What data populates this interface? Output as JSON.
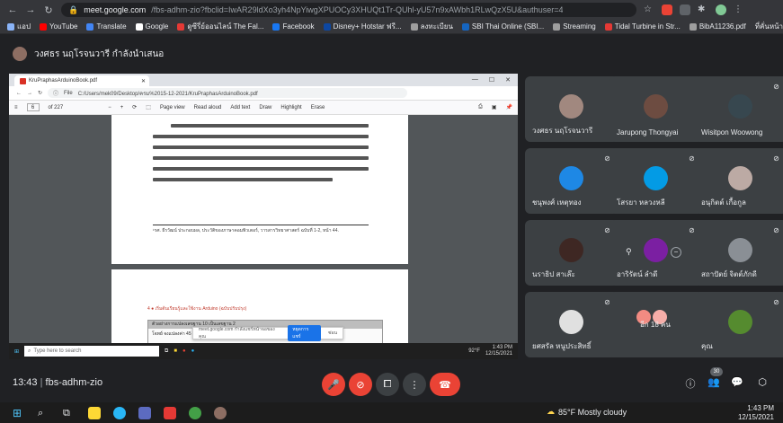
{
  "browser": {
    "url_host": "meet.google.com",
    "url_rest": "/fbs-adhm-zio?fbclid=IwAR29ldXo3yh4NpYiwgXPUOCy3XHUQt1Tr-QUhl-yU57n9xAWbh1RLwQzX5U&authuser=4",
    "bookmarks": [
      {
        "label": "แอป",
        "color": "#8ab4f8"
      },
      {
        "label": "YouTube",
        "color": "#ff0000"
      },
      {
        "label": "Translate",
        "color": "#4285f4"
      },
      {
        "label": "Google",
        "color": "#ffffff"
      },
      {
        "label": "ดูซีรี่ย์ออนไลน์ The Fal...",
        "color": "#e53935"
      },
      {
        "label": "Facebook",
        "color": "#1877f2"
      },
      {
        "label": "Disney+ Hotstar ฟรี...",
        "color": "#0d47a1"
      },
      {
        "label": "ลงทะเบียน",
        "color": "#9e9e9e"
      },
      {
        "label": "SBI Thai Online (SBI...",
        "color": "#1565c0"
      },
      {
        "label": "Streaming",
        "color": "#9e9e9e"
      },
      {
        "label": "Tidal Turbine in Str...",
        "color": "#e53935"
      },
      {
        "label": "BibA11236.pdf",
        "color": "#9e9e9e"
      }
    ],
    "bookmarks_other": "ที่คั่นหน้าอื่น"
  },
  "presenter": {
    "label": "วงศธร นฤโรจนวารี กำลังนำเสนอ"
  },
  "shared_screen": {
    "tab_title": "KruPraphasArduinoBook.pdf",
    "file_label": "File",
    "file_path": "C:/Users/mek09/Desktop/ครม%2015-12-2021/KruPraphasArduinoBook.pdf",
    "page_current": "6",
    "page_total": "of 227",
    "toolbar": {
      "page_view": "Page view",
      "read_aloud": "Read aloud",
      "add_text": "Add text",
      "draw": "Draw",
      "highlight": "Highlight",
      "erase": "Erase"
    },
    "footnote": "¹รศ. ธีรวัฒน์ ประกอบผล, ประวัติของภาษาคอมพิวเตอร์, วารสารวิทยาศาสตร์ ฉบับที่ 1-2, หน้า 44.",
    "section_heading": "4 ● เริ่มต้นเรียนรู้และใช้งาน Arduino (ฉบับปรับปรุง)",
    "code_box_heading": "ตัวอย่างการแปลงเลขฐาน 10 เป็นเลขฐาน 2",
    "code_line": "โจทย์ จงแปลงค่า 45",
    "share_notice_text": "meet.google.com กำลังแชร์หน้าจอของคุณ",
    "share_notice_stop": "หยุดการแชร์",
    "share_notice_hide": "ซ่อน",
    "inner_search": "Type here to search",
    "inner_temp": "92°F",
    "inner_time": "1:43 PM",
    "inner_date": "12/15/2021"
  },
  "participants": [
    {
      "name": "วงศธร นฤโรจนวารี",
      "muted": false,
      "avatar_color": "#a1887f"
    },
    {
      "name": "Jarupong Thongyai",
      "muted": false,
      "avatar_color": "#6d4c41"
    },
    {
      "name": "Wisitpon Woowong",
      "muted": true,
      "avatar_color": "#37474f"
    },
    {
      "name": "ชนุพงศ์ เหตุทอง",
      "muted": true,
      "avatar_color": "#1e88e5"
    },
    {
      "name": "โสรยา หลวงหลี",
      "muted": true,
      "avatar_color": "#039be5"
    },
    {
      "name": "อนุกิตต์ เกื้อกูล",
      "muted": true,
      "avatar_color": "#bcaaa4"
    },
    {
      "name": "นราธิป สาเล๊ะ",
      "muted": true,
      "avatar_color": "#3e2723"
    },
    {
      "name": "อาริรัตน์ ลำดี",
      "muted": true,
      "avatar_color": "#7b1fa2"
    },
    {
      "name": "สถาปัตย์ จิตต์ภักดี",
      "muted": true,
      "avatar_color": "#8a8f95"
    },
    {
      "name": "ยศสรัล หนูประสิทธิ์",
      "muted": true,
      "avatar_color": "#e0e0e0"
    },
    {
      "name": "อีก 18 คน",
      "muted": false,
      "avatar_color": "#f28b82"
    },
    {
      "name": "คุณ",
      "muted": true,
      "avatar_color": "#558b2f"
    }
  ],
  "callbar": {
    "time": "13:43",
    "separator": "|",
    "meeting_code": "fbs-adhm-zio",
    "people_count": "30"
  },
  "taskbar": {
    "weather": "85°F  Mostly cloudy",
    "time": "1:43 PM",
    "date": "12/15/2021"
  },
  "colors": {
    "meet_bg": "#202124",
    "tile_bg": "#3c4043",
    "danger_red": "#ea4335"
  }
}
